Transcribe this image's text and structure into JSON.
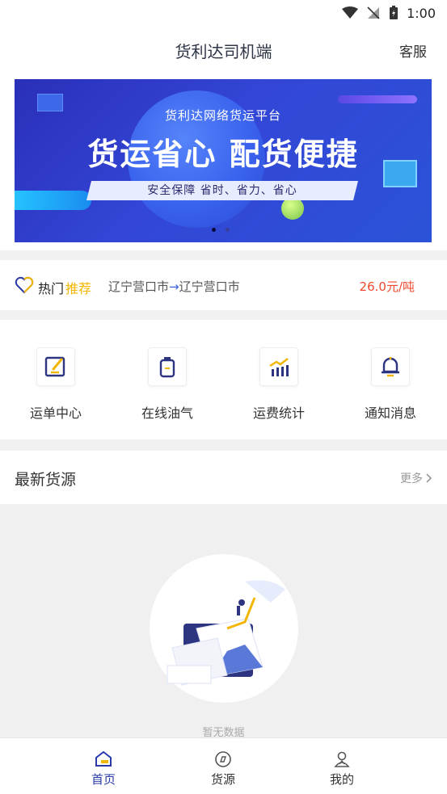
{
  "status_bar": {
    "time": "1:00"
  },
  "header": {
    "title": "货利达司机端",
    "service_label": "客服"
  },
  "banner": {
    "subtitle": "货利达网络货运平台",
    "title": "货运省心 配货便捷",
    "slogan": "安全保障 省时、省力、省心",
    "page_count": 2,
    "active_page": 1
  },
  "hot_route": {
    "label_a": "热门",
    "label_b": "推荐",
    "from": "辽宁营口市",
    "arrow": "→",
    "to": "辽宁营口市",
    "price": "26.0元/吨"
  },
  "quick_menu": [
    {
      "label": "运单中心",
      "icon": "edit-document-icon"
    },
    {
      "label": "在线油气",
      "icon": "fuel-can-icon"
    },
    {
      "label": "运费统计",
      "icon": "bar-chart-icon"
    },
    {
      "label": "通知消息",
      "icon": "bell-icon"
    }
  ],
  "latest": {
    "title": "最新货源",
    "more_label": "更多",
    "empty_text": "暂无数据"
  },
  "bottom_nav": [
    {
      "label": "首页",
      "icon": "home-icon",
      "active": true
    },
    {
      "label": "货源",
      "icon": "compass-icon",
      "active": false
    },
    {
      "label": "我的",
      "icon": "profile-icon",
      "active": false
    }
  ],
  "colors": {
    "accent": "#2a3aa8",
    "highlight_yellow": "#f2b600",
    "price_red": "#f04a2c"
  }
}
